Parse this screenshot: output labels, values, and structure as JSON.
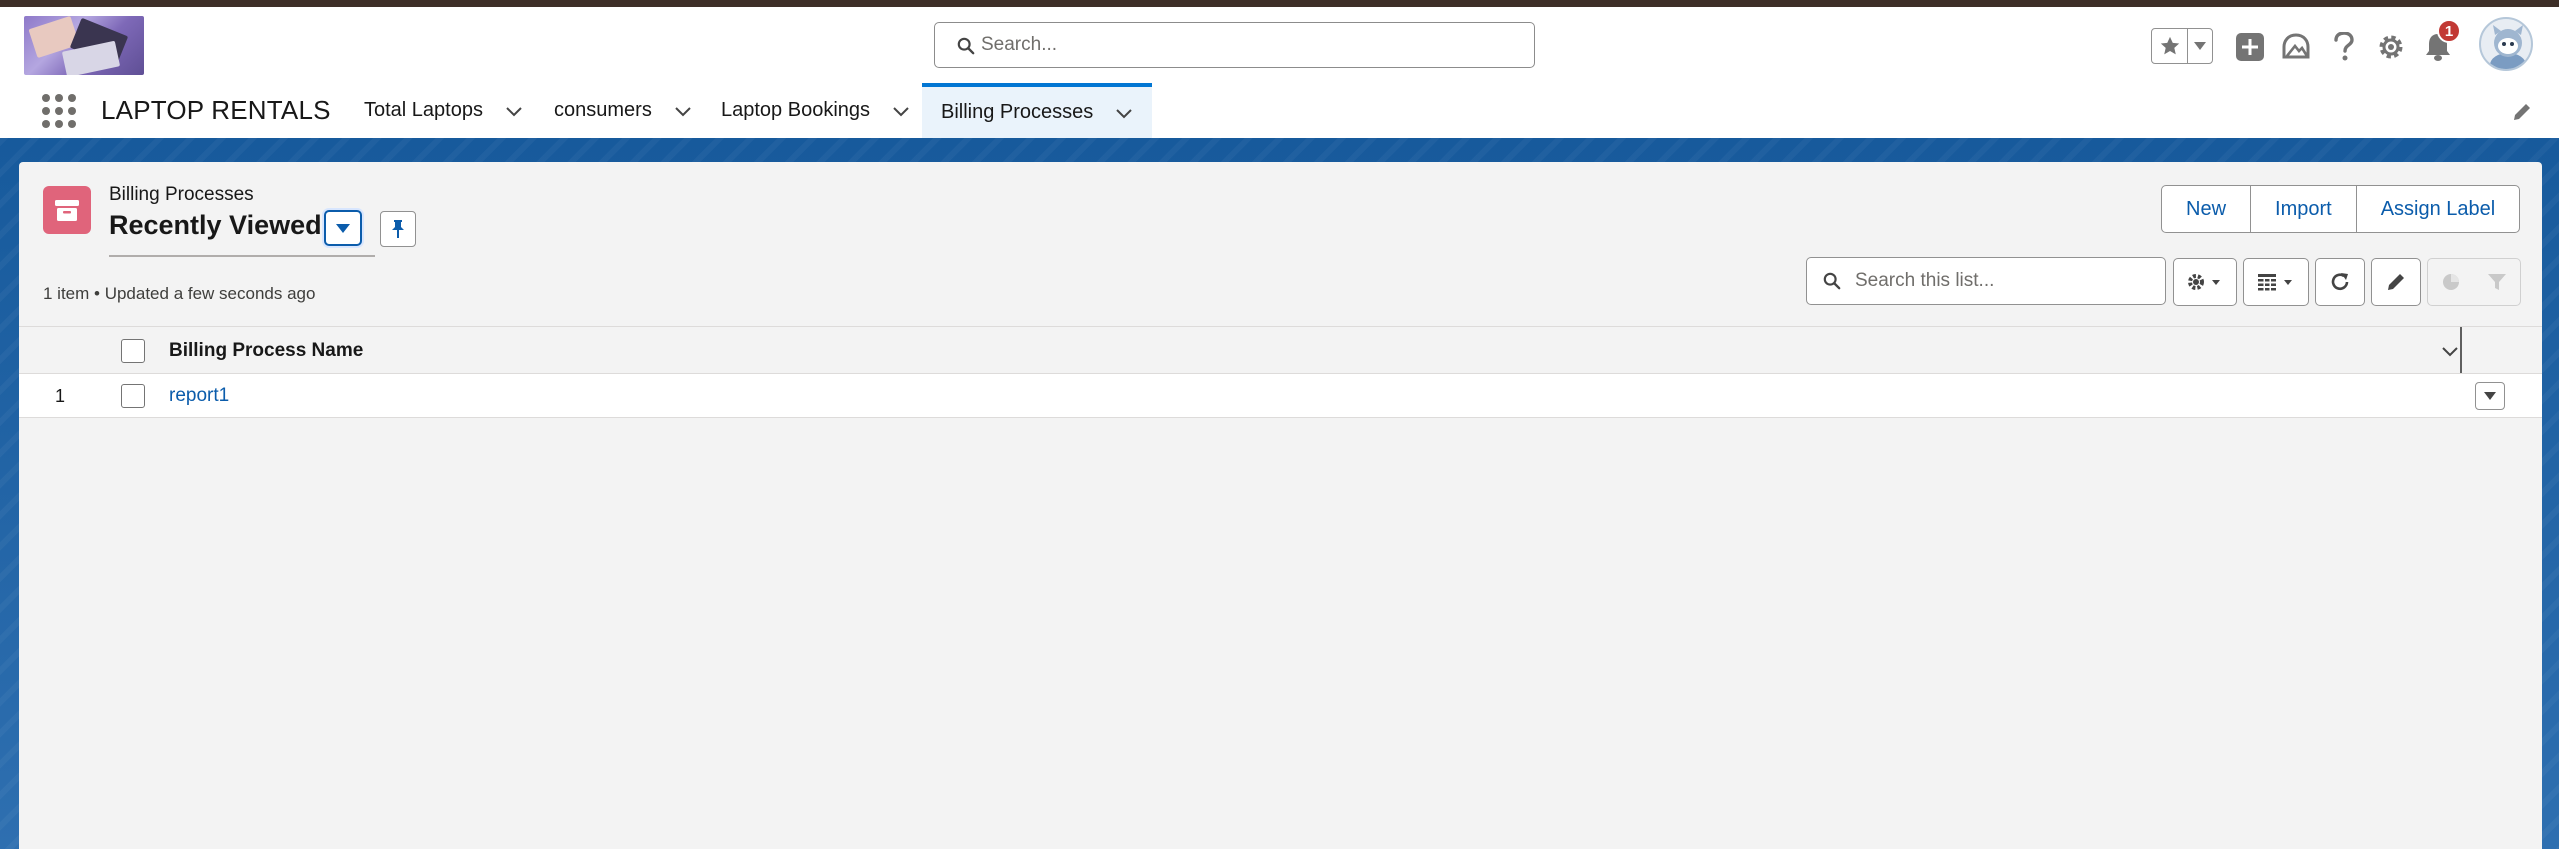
{
  "header": {
    "search_placeholder": "Search...",
    "notification_count": "1",
    "icons": [
      "favorites-star-icon",
      "favorites-caret-icon",
      "global-add-icon",
      "trailhead-icon",
      "help-icon",
      "setup-gear-icon",
      "notification-bell-icon",
      "user-avatar"
    ]
  },
  "nav": {
    "app_name": "LAPTOP RENTALS",
    "tabs": [
      {
        "label": "Total Laptops",
        "active": false
      },
      {
        "label": "consumers",
        "active": false
      },
      {
        "label": "Laptop Bookings",
        "active": false
      },
      {
        "label": "Billing Processes",
        "active": true
      }
    ]
  },
  "list_header": {
    "object_label": "Billing Processes",
    "list_view_name": "Recently Viewed",
    "meta": "1 item • Updated a few seconds ago",
    "buttons": {
      "new": "New",
      "import": "Import",
      "assign_label": "Assign Label"
    },
    "search_placeholder": "Search this list..."
  },
  "table": {
    "columns": [
      "Billing Process Name"
    ],
    "rows": [
      {
        "num": "1",
        "name": "report1"
      }
    ]
  },
  "colors": {
    "brand_blue": "#0176d3",
    "link_blue": "#0b5cab",
    "object_icon": "#e0647b",
    "badge_red": "#c23934",
    "banner": "#1c5fa3"
  }
}
